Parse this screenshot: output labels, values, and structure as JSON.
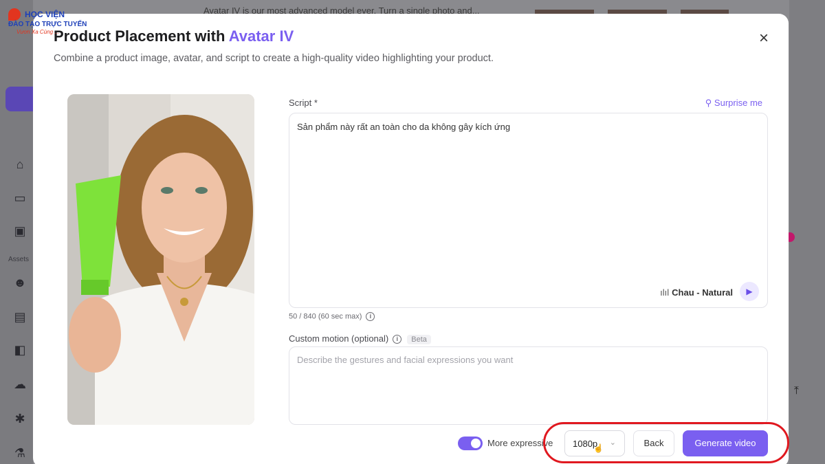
{
  "logo": {
    "line1": "HỌC VIỆN",
    "line2": "ĐÀO TẠO TRỰC TUYẾN",
    "line3": "Vươn Xa Cùng ..."
  },
  "background": {
    "top_text": "Avatar IV is our most advanced model ever. Turn a single photo and...",
    "assets_label": "Assets"
  },
  "modal": {
    "title_prefix": "Product Placement with",
    "title_accent": "Avatar IV",
    "subtitle": "Combine a product image, avatar, and script to create a high-quality video highlighting your product."
  },
  "script": {
    "label": "Script *",
    "surprise_label": "Surprise me",
    "text": "Sản phẩm này rất an toàn cho da không gây kích ứng",
    "voice": "Chau - Natural",
    "char_count": "50 / 840 (60 sec max)"
  },
  "motion": {
    "label": "Custom motion (optional)",
    "badge": "Beta",
    "placeholder": "Describe the gestures and facial expressions you want"
  },
  "footer": {
    "toggle_label": "More expressive",
    "toggle_on": true,
    "resolution": "1080p",
    "back_label": "Back",
    "generate_label": "Generate video"
  },
  "colors": {
    "accent": "#7a5ff0",
    "highlight": "#e0181f"
  }
}
